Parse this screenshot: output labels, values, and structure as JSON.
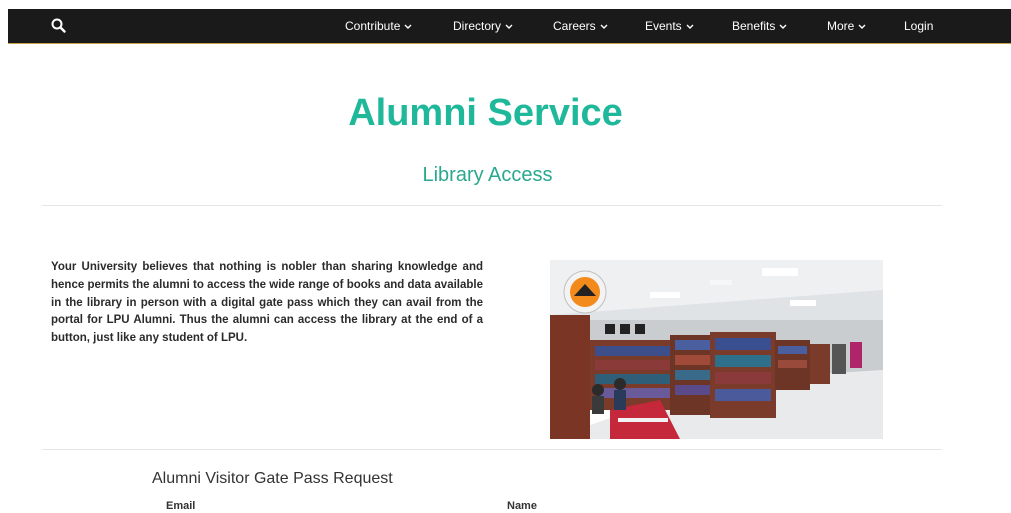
{
  "nav": {
    "items": [
      {
        "label": "Contribute",
        "dropdown": true
      },
      {
        "label": "Directory",
        "dropdown": true
      },
      {
        "label": "Careers",
        "dropdown": true
      },
      {
        "label": "Events",
        "dropdown": true
      },
      {
        "label": "Benefits",
        "dropdown": true
      },
      {
        "label": "More",
        "dropdown": true
      },
      {
        "label": "Login",
        "dropdown": false
      }
    ],
    "search_icon": "search-icon",
    "bar_color": "#1a1a1a"
  },
  "hero": {
    "title": "Alumni Service",
    "subtitle": "Library Access",
    "accent_color": "#1fb89a"
  },
  "intro": {
    "text": "Your University believes that nothing is nobler than sharing knowledge and hence permits the alumni to access the wide range of books and data available in the library in person with a digital gate pass which they can avail from the portal for LPU Alumni. Thus the alumni can access the library at the end of a button, just like any student of LPU."
  },
  "form": {
    "title": "Alumni Visitor Gate Pass Request",
    "email_label": "Email",
    "name_label": "Name"
  }
}
